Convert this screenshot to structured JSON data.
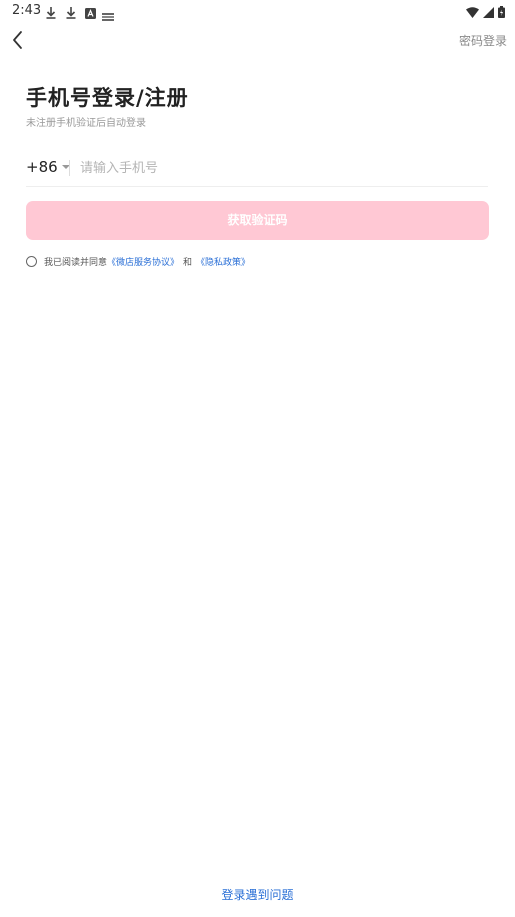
{
  "status_bar": {
    "time": "2:43",
    "left_icons": [
      "download-icon",
      "download-icon",
      "translate-icon",
      "sim-icon"
    ],
    "right_icons": [
      "wifi-icon",
      "signal-icon",
      "battery-icon"
    ]
  },
  "nav": {
    "back_icon": "chevron-left-icon",
    "password_login": "密码登录"
  },
  "header": {
    "title": "手机号登录/注册",
    "subtitle": "未注册手机验证后自动登录"
  },
  "phone": {
    "country_code": "+86",
    "placeholder": "请输入手机号",
    "value": ""
  },
  "actions": {
    "get_code": "获取验证码",
    "button_color": "#ffc8d4"
  },
  "agreement": {
    "prefix": "我已阅读并同意",
    "service_link": "《微店服务协议》",
    "and": "和",
    "privacy_link": "《隐私政策》",
    "link_color": "#2a6fd6"
  },
  "footer": {
    "help": "登录遇到问题"
  }
}
